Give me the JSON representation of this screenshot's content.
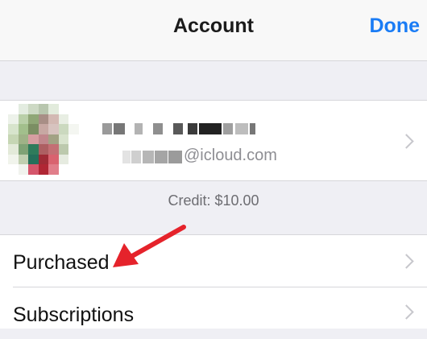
{
  "nav": {
    "title": "Account",
    "done_label": "Done"
  },
  "account": {
    "email_suffix": "@icloud.com",
    "avatar_icon": "blurred-avatar-icon",
    "chevron_icon": "chevron-right-icon"
  },
  "credit": {
    "text": "Credit: $10.00"
  },
  "list": {
    "items": [
      {
        "label": "Purchased"
      },
      {
        "label": "Subscriptions"
      }
    ]
  },
  "colors": {
    "accent": "#1a7cf5",
    "annotation_arrow": "#e5232b",
    "background": "#efeff4"
  }
}
